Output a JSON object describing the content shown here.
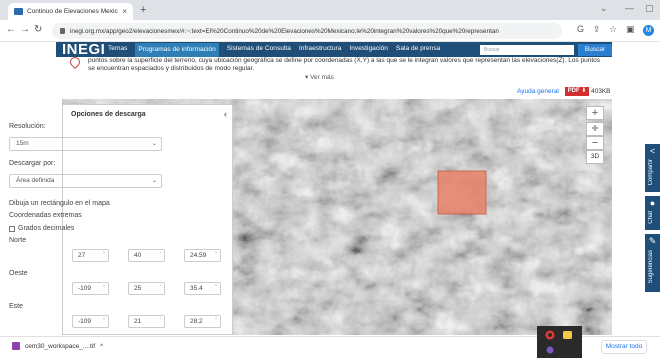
{
  "browser": {
    "tab_title": "Continuo de Elevaciones Mexica",
    "tab_close": "×",
    "new_tab": "+",
    "url": "inegi.org.mx/app/geo2/elevacionesmex/#:~:text=El%20Continuo%20de%20Elevaciones%20Mexicano,le%20integran%20valores%20que%20representan",
    "profile_initial": "M",
    "icons": [
      "back-icon",
      "forward-icon",
      "reload-icon",
      "google-icon",
      "share-icon",
      "star-icon",
      "sidebar-icon"
    ]
  },
  "site": {
    "logo": "INEGI",
    "nav": [
      "Temas",
      "Programas de información",
      "Sistemas de Consulta",
      "Infraestructura",
      "Investigación",
      "Sala de prensa"
    ],
    "active_nav": "Programas de información",
    "search_placeholder": "Buscar",
    "search_button": "Buscar",
    "intro_text": "puntos sobre la superficie del terreno, cuya ubicación geográfica se define por coordenadas (X,Y) a las que se le integran valores que representan las elevaciones(Z). Los puntos se encuentran espaciados y distribuidos de modo regular.",
    "ver_mas": "▾ Ver más",
    "ayuda": "Ayuda general",
    "pdf_badge": "PDF ⬇",
    "pdf_size": "403KB"
  },
  "panel": {
    "title": "Opciones de descarga",
    "collapse": "‹",
    "resolution_label": "Resolución:",
    "resolution_value": "15m",
    "download_label": "Descargar por:",
    "download_value": "Área definida",
    "instruction": "Dibuja un rectángulo en el mapa",
    "coords_label": "Coordenadas extremas",
    "decimal_label": "Grados decimales",
    "norte_label": "Norte",
    "norte": [
      "27",
      "40",
      "24.59"
    ],
    "oeste_label": "Oeste",
    "oeste": [
      "-109",
      "25",
      "35.4"
    ],
    "este_label": "Este",
    "este": [
      "-109",
      "21",
      "28.2"
    ],
    "units": [
      "°",
      "'",
      "\""
    ]
  },
  "map": {
    "zoom_in": "+",
    "compass": "✛",
    "zoom_out": "−",
    "view_3d": "3D",
    "selection_color": "#e8836a"
  },
  "sidebar": {
    "compartir": "Compartir",
    "chat": "Chat",
    "sugerencias": "Sugerencias"
  },
  "downloads": {
    "file_name": "cem30_workspace_....tif",
    "expand": "^",
    "show_all": "Mostrar todo"
  }
}
